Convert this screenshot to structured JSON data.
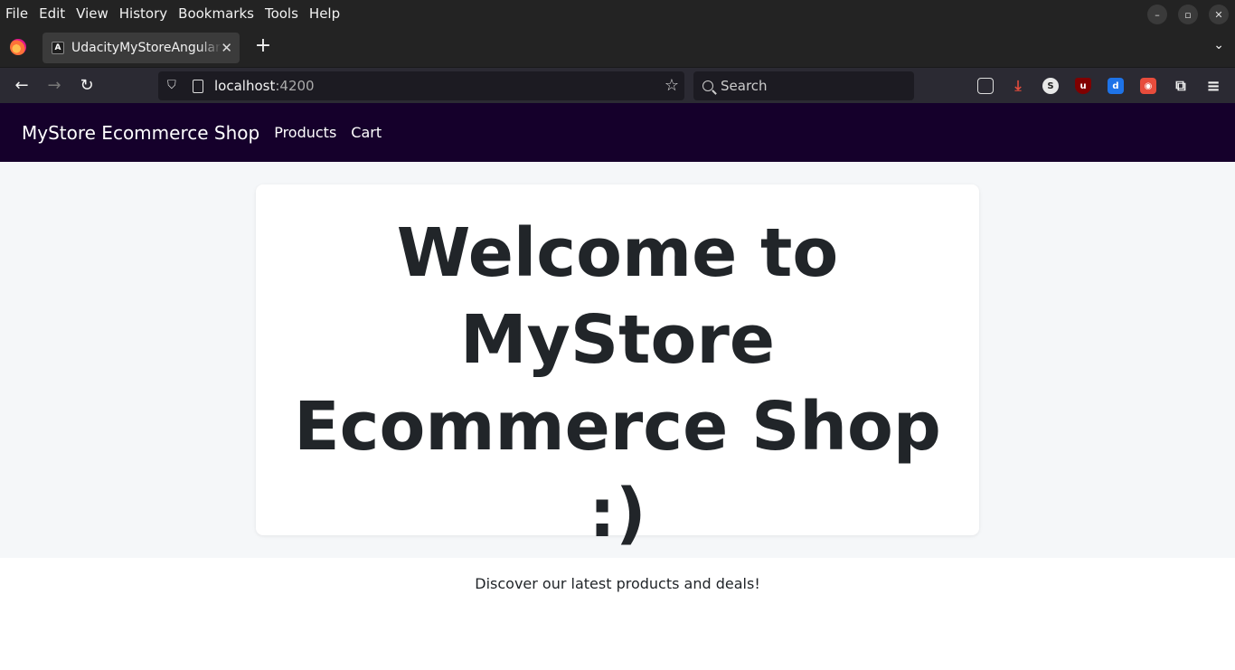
{
  "browser": {
    "menu": [
      "File",
      "Edit",
      "View",
      "History",
      "Bookmarks",
      "Tools",
      "Help"
    ],
    "tab_title": "UdacityMyStoreAngularProject",
    "tab_favicon": "A",
    "url_host": "localhost",
    "url_port": ":4200",
    "search_placeholder": "Search"
  },
  "app": {
    "brand": "MyStore Ecommerce Shop",
    "nav": [
      "Products",
      "Cart"
    ],
    "hero": {
      "title": "Welcome to MyStore Ecommerce Shop :)",
      "subtitle": "Discover our latest products and deals!"
    }
  },
  "colors": {
    "header_bg": "#15002b",
    "content_bg": "#f5f7f9",
    "text": "#212529"
  }
}
